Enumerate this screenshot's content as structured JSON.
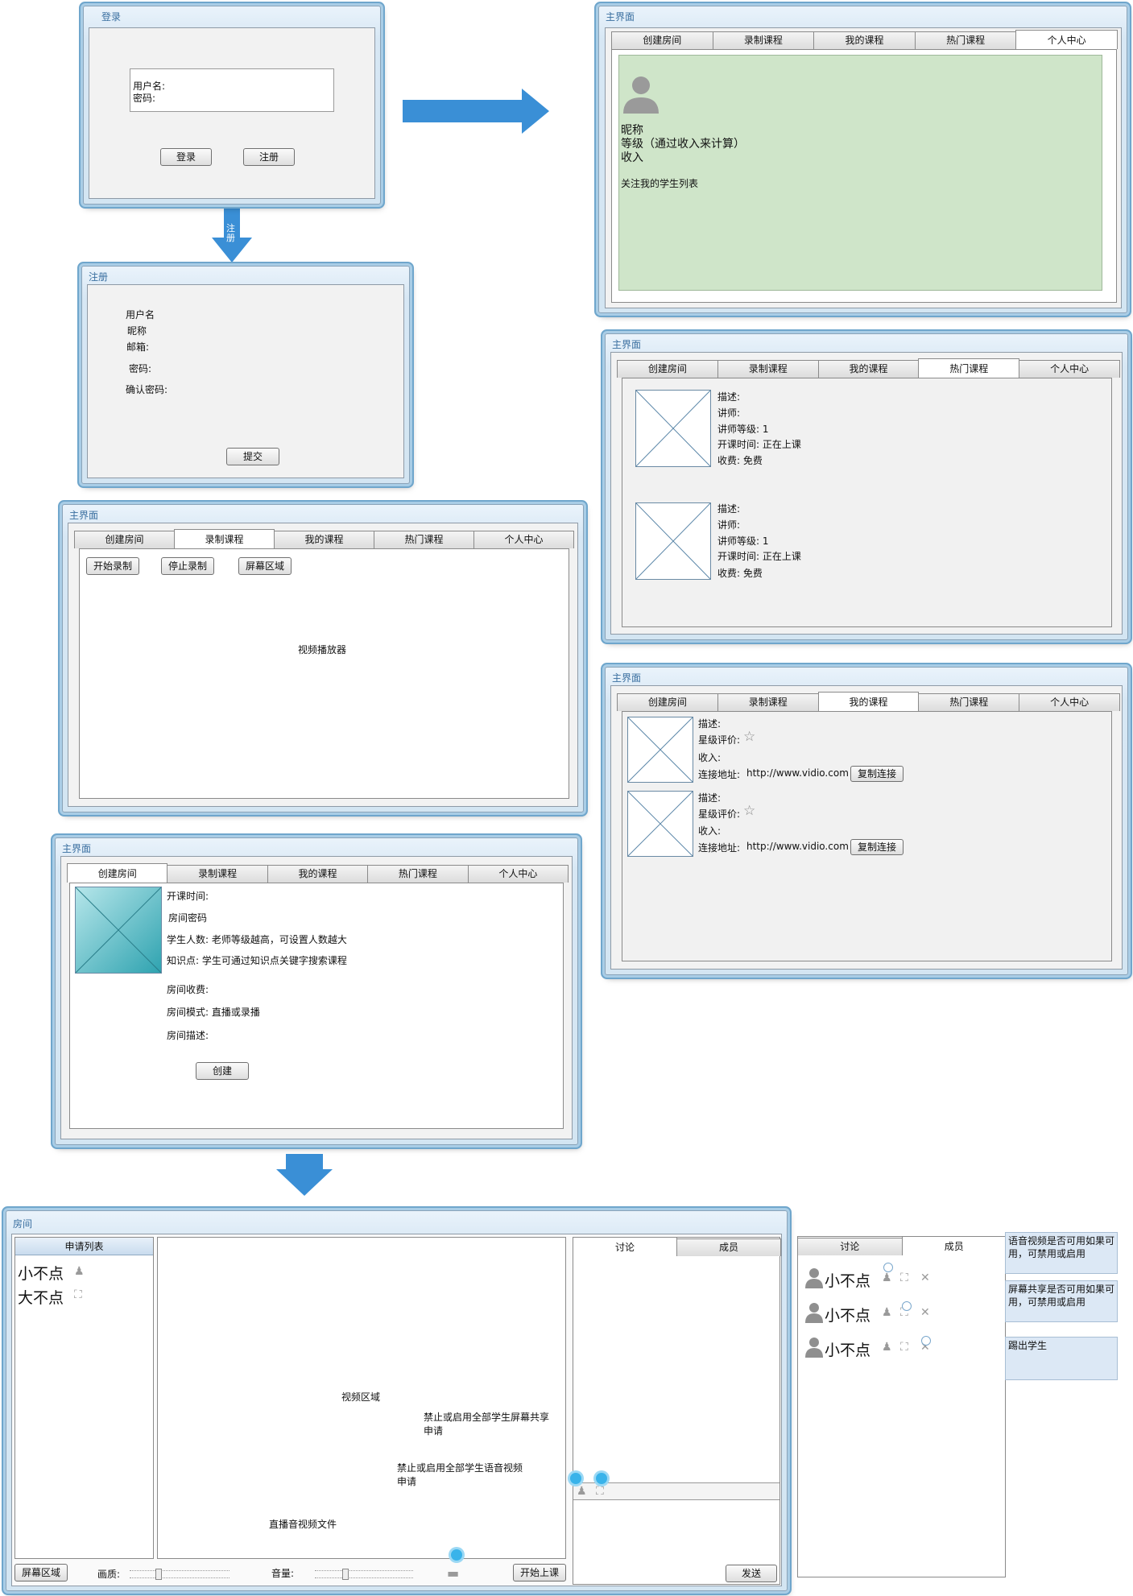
{
  "login": {
    "title": "登录",
    "username_label": "用户名:",
    "password_label": "密码:",
    "login_button": "登录",
    "register_button": "注册"
  },
  "arrow_register_label": "注册",
  "register": {
    "title": "注册",
    "fields": [
      "用户名",
      "昵称",
      "邮箱:",
      "密码:",
      "确认密码:"
    ],
    "submit_button": "提交"
  },
  "tabs": [
    "创建房间",
    "录制课程",
    "我的课程",
    "热门课程",
    "个人中心"
  ],
  "main_title": "主界面",
  "personal": {
    "nickname": "昵称",
    "level": "等级（通过收入来计算）",
    "income": "收入",
    "follow_list": "关注我的学生列表",
    "panel_color": "#cfe5c9"
  },
  "hot": {
    "items": [
      {
        "desc": "描述:",
        "teacher": "讲师:",
        "level": "讲师等级: 1",
        "time": "开课时间: 正在上课",
        "fee": "收费: 免费"
      },
      {
        "desc": "描述:",
        "teacher": "讲师:",
        "level": "讲师等级: 1",
        "time": "开课时间: 正在上课",
        "fee": "收费: 免费"
      }
    ]
  },
  "record": {
    "start_button": "开始录制",
    "stop_button": "停止录制",
    "screen_button": "屏幕区域",
    "player_label": "视频播放器"
  },
  "mycourse": {
    "items": [
      {
        "desc": "描述:",
        "rating": "星级评价:",
        "income": "收入:",
        "link_label": "连接地址:",
        "link": "http://www.vidio.com",
        "copy_button": "复制连接"
      },
      {
        "desc": "描述:",
        "rating": "星级评价:",
        "income": "收入:",
        "link_label": "连接地址:",
        "link": "http://www.vidio.com",
        "copy_button": "复制连接"
      }
    ]
  },
  "create": {
    "fields": [
      "开课时间:",
      "房间密码",
      "学生人数: 老师等级越高，可设置人数越大",
      "知识点: 学生可通过知识点关键字搜索课程",
      "房间收费:",
      "房间模式: 直播或录播",
      "房间描述:"
    ],
    "create_button": "创建"
  },
  "room": {
    "title": "房间",
    "apply_list_header": "申请列表",
    "applicants": [
      "小不点",
      "大不点"
    ],
    "video_area": "视频区域",
    "tab_discuss": "讨论",
    "tab_members": "成员",
    "send_button": "发送",
    "screen_button": "屏幕区域",
    "quality_label": "画质:",
    "volume_label": "音量:",
    "start_class_button": "开始上课",
    "note_screen_share_all": "禁止或启用全部学生屏幕共享申请",
    "note_voice_all": "禁止或启用全部学生语音视频申请",
    "note_live_file": "直播音视频文件"
  },
  "members": {
    "tab_discuss": "讨论",
    "tab_members": "成员",
    "names": [
      "小不点",
      "小不点",
      "小不点"
    ],
    "note_voice": "语音视频是否可用如果可用，可禁用或启用",
    "note_screen": "屏幕共享是否可用如果可用，可禁用或启用",
    "note_kick": "踢出学生"
  },
  "colors": {
    "arrow": "#3a8fd6",
    "highlight": "#39b3ea"
  }
}
